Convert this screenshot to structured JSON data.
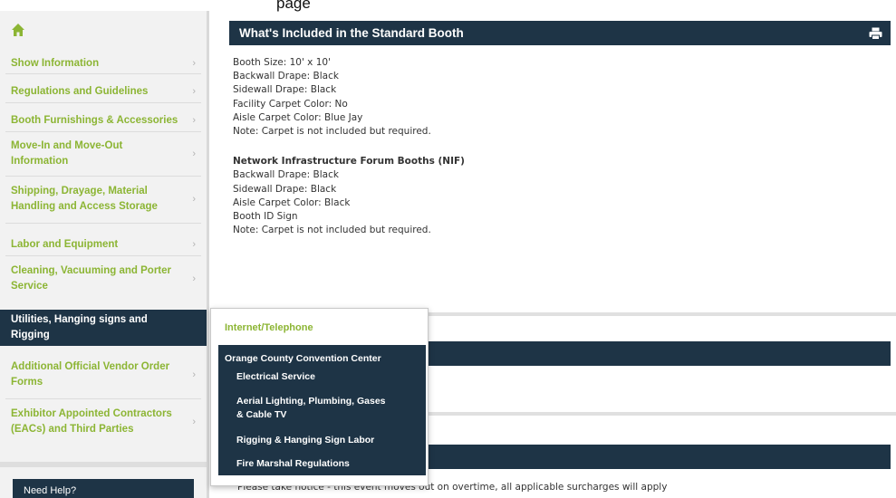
{
  "page": {
    "breadcrumb_fragment": "page"
  },
  "sidebar": {
    "home_icon": "home-icon",
    "items": [
      {
        "label": "Show Information"
      },
      {
        "label": "Regulations and Guidelines"
      },
      {
        "label": "Booth Furnishings & Accessories"
      },
      {
        "label": "Move-In and Move-Out Information"
      },
      {
        "label": "Shipping, Drayage, Material Handling and Access Storage"
      },
      {
        "label": "Labor and Equipment"
      },
      {
        "label": "Cleaning, Vacuuming and Porter Service"
      },
      {
        "label": "Utilities, Hanging signs and Rigging",
        "active": true
      },
      {
        "label": "Additional Official Vendor Order Forms"
      },
      {
        "label": "Exhibitor Appointed Contractors (EACs) and Third Parties"
      }
    ],
    "help_label": "Need Help?"
  },
  "main": {
    "standard_booth": {
      "title": "What's Included in the Standard Booth",
      "lines": [
        "Booth Size: 10' x 10'",
        "Backwall Drape: Black",
        "Sidewall Drape: Black",
        "Facility Carpet Color: No",
        "Aisle Carpet Color: Blue Jay",
        "Note: Carpet is not included but required."
      ],
      "nif_heading": "Network Infrastructure Forum Booths (NIF)",
      "nif_lines": [
        "Backwall Drape: Black",
        "Sidewall Drape: Black",
        "Aisle Carpet Color: Black",
        "Booth ID Sign",
        "Note: Carpet is not included but required."
      ]
    },
    "overtime_notice": "Please take notice - this event moves out on overtime, all applicable surcharges will apply"
  },
  "dropdown": {
    "link": "Internet/Telephone",
    "submenu_title": "Orange County Convention Center",
    "submenu_items": [
      "Electrical Service",
      "Aerial Lighting, Plumbing, Gases & Cable TV",
      "Rigging & Hanging Sign Labor",
      "Fire Marshal Regulations"
    ]
  },
  "colors": {
    "navy": "#1e3446",
    "green_link": "#8cb534",
    "sidebar_bg": "#f2f2f2"
  }
}
